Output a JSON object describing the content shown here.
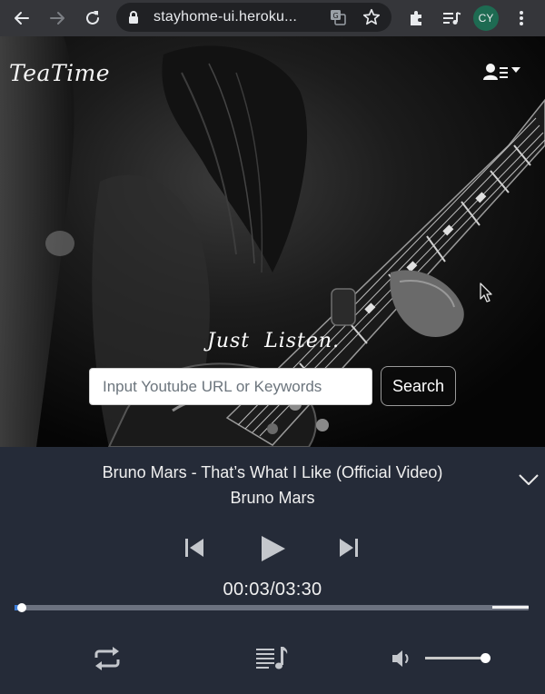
{
  "browser": {
    "url": "stayhome-ui.heroku...",
    "profile_initials": "CY",
    "icons": [
      "back-arrow-icon",
      "forward-arrow-icon",
      "reload-icon",
      "lock-icon",
      "translate-icon",
      "star-icon",
      "extensions-icon",
      "media-control-icon",
      "more-vert-icon"
    ]
  },
  "app": {
    "logo": "TeaTime",
    "tagline": "Just Listen.",
    "search_placeholder": "Input Youtube URL or Keywords",
    "search_button": "Search",
    "icons": [
      "user-menu-icon",
      "caret-down-icon"
    ]
  },
  "player": {
    "title": "Bruno Mars - That’s What I Like (Official Video)",
    "artist": "Bruno Mars",
    "time_display": "00:03/03:30",
    "progress_fraction": 0.014,
    "buffer_fraction": 0.93,
    "volume_fraction": 1.0,
    "colors": {
      "background": "#252b38",
      "progress_fill": "#3d7dd8",
      "controls": "#c4c7cc"
    },
    "icons": [
      "chevron-down-icon",
      "skip-previous-icon",
      "play-icon",
      "skip-next-icon",
      "repeat-icon",
      "playlist-icon",
      "volume-icon"
    ]
  }
}
